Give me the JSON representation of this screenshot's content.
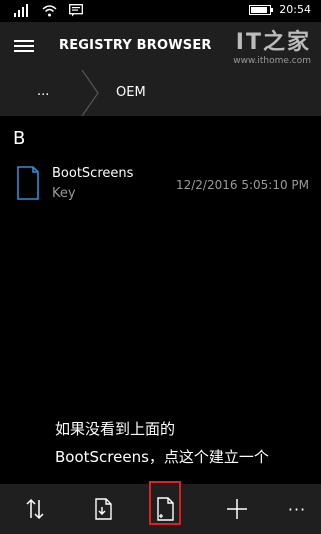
{
  "status_bar": {
    "time": "20:54",
    "icons": [
      "signal-bars-icon",
      "wifi-icon",
      "message-icon"
    ],
    "battery_level": 0.85
  },
  "header": {
    "title": "REGISTRY BROWSER",
    "watermark_logo": "IT之家",
    "watermark_url": "www.ithome.com"
  },
  "breadcrumb": {
    "root": "...",
    "current": "OEM"
  },
  "content": {
    "group_header": "B",
    "items": [
      {
        "name": "BootScreens",
        "type": "Key",
        "date": "12/2/2016 5:05:10 PM",
        "icon": "key-folder-icon"
      }
    ]
  },
  "annotation": {
    "line1": "如果没看到上面的",
    "line2": "BootScreens，点这个建立一个"
  },
  "app_bar": {
    "buttons": [
      "sort-icon",
      "import-icon",
      "new-key-icon",
      "add-icon",
      "more-icon"
    ],
    "more_label": "···",
    "highlight_color": "#e0201e"
  },
  "colors": {
    "background": "#000000",
    "bar": "#1f1f1f",
    "accent": "#2f8fd8",
    "secondary_text": "#9a9a9a"
  }
}
